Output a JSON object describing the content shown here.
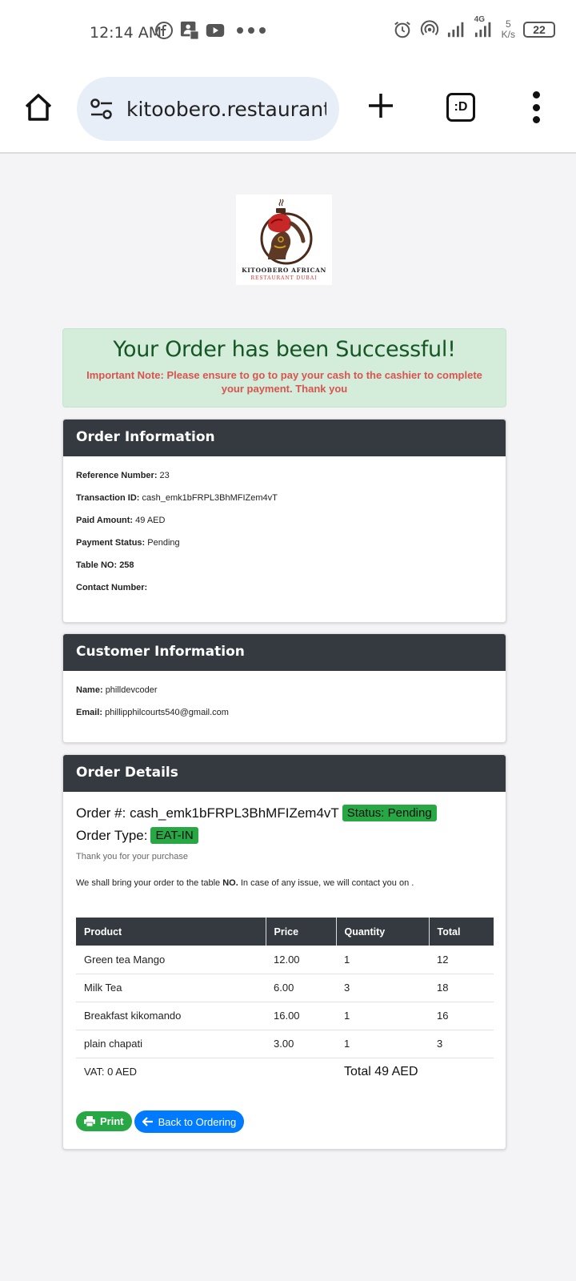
{
  "status_bar": {
    "time": "12:14 AM",
    "net_speed_value": "5",
    "net_speed_unit": "K/s",
    "network": "4G",
    "battery": "22",
    "icons": [
      "facebook-icon",
      "photo-icon",
      "youtube-icon",
      "more-dots-icon",
      "alarm-icon",
      "hotspot-icon",
      "signal-icon",
      "signal-4g-icon",
      "battery-icon"
    ]
  },
  "browser": {
    "url": "kitoobero.restaurant/c",
    "tabs_label": ":D"
  },
  "logo": {
    "line1": "KITOOBERO AFRICAN",
    "line2": "RESTAURANT DUBAI"
  },
  "alert": {
    "title": "Your Order has been Successful!",
    "note": "Important Note: Please ensure to go to pay your cash to the cashier to complete your payment. Thank you"
  },
  "order_info": {
    "header": "Order Information",
    "reference_label": "Reference Number:",
    "reference_value": "23",
    "transaction_label": "Transaction ID:",
    "transaction_value": "cash_emk1bFRPL3BhMFIZem4vT",
    "paid_label": "Paid Amount:",
    "paid_value": "49 AED",
    "payment_status_label": "Payment Status:",
    "payment_status_value": "Pending",
    "table_label": "Table NO: 258",
    "contact_label": "Contact Number:"
  },
  "customer_info": {
    "header": "Customer Information",
    "name_label": "Name:",
    "name_value": "philldevcoder",
    "email_label": "Email:",
    "email_value": "phillipphilcourts540@gmail.com"
  },
  "order_details": {
    "header": "Order Details",
    "order_no_label": "Order #: cash_emk1bFRPL3BhMFIZem4vT",
    "status_badge": "Status: Pending",
    "order_type_label": "Order Type:",
    "order_type_badge": "EAT-IN",
    "thanks": "Thank you for your purchase",
    "deliver_pre": "We shall bring your order to the table ",
    "deliver_bold": "NO.",
    "deliver_post": " In case of any issue, we will contact you on .",
    "columns": [
      "Product",
      "Price",
      "Quantity",
      "Total"
    ],
    "items": [
      {
        "product": "Green tea Mango",
        "price": "12.00",
        "quantity": "1",
        "total": "12"
      },
      {
        "product": "Milk Tea",
        "price": "6.00",
        "quantity": "3",
        "total": "18"
      },
      {
        "product": "Breakfast kikomando",
        "price": "16.00",
        "quantity": "1",
        "total": "16"
      },
      {
        "product": "plain chapati",
        "price": "3.00",
        "quantity": "1",
        "total": "3"
      }
    ],
    "vat": "VAT: 0 AED",
    "grand_total": "Total 49 AED",
    "print_label": "Print",
    "back_label": "Back to Ordering"
  },
  "colors": {
    "header_dark": "#343a40",
    "success_bg": "#d4ecda",
    "success_text": "#155724",
    "note_red": "#d9534f",
    "badge_green": "#28a745",
    "button_blue": "#007bff"
  }
}
